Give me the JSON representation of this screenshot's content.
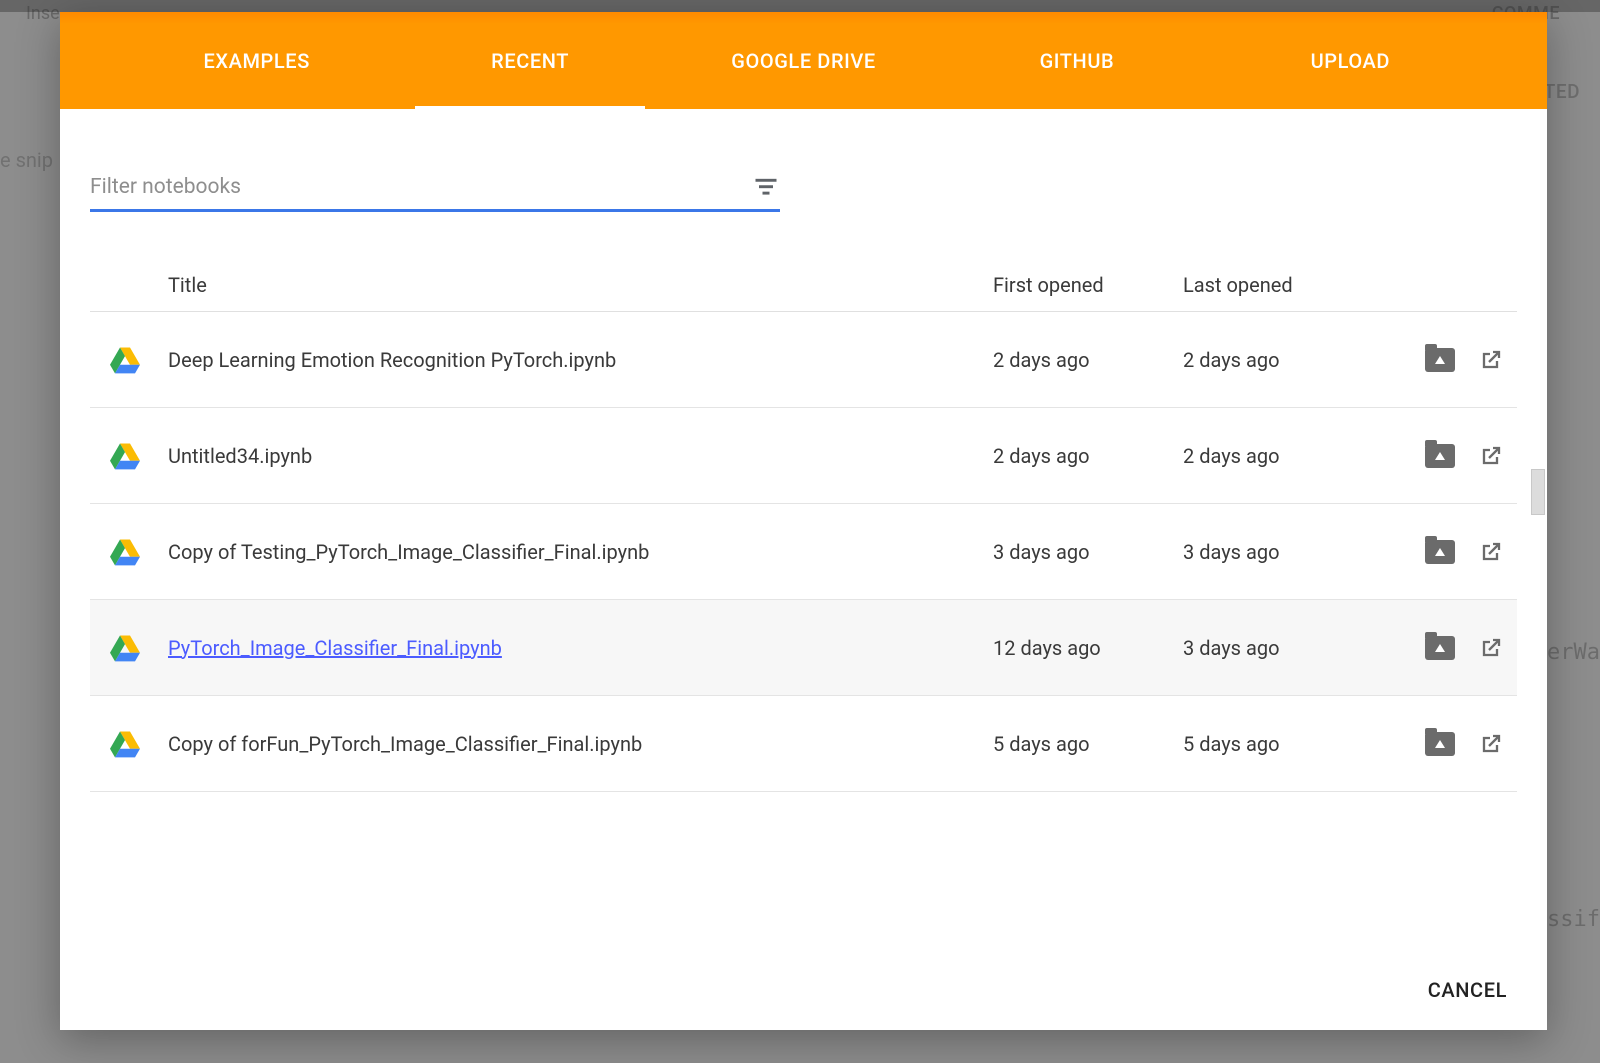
{
  "tabs": [
    {
      "label": "EXAMPLES"
    },
    {
      "label": "RECENT"
    },
    {
      "label": "GOOGLE DRIVE"
    },
    {
      "label": "GITHUB"
    },
    {
      "label": "UPLOAD"
    }
  ],
  "active_tab_index": 1,
  "filter": {
    "placeholder": "Filter notebooks",
    "value": ""
  },
  "columns": {
    "title": "Title",
    "first": "First opened",
    "last": "Last opened"
  },
  "rows": [
    {
      "title": "Deep Learning Emotion Recognition PyTorch.ipynb",
      "first": "2 days ago",
      "last": "2 days ago",
      "hover": false,
      "link": false
    },
    {
      "title": "Untitled34.ipynb",
      "first": "2 days ago",
      "last": "2 days ago",
      "hover": false,
      "link": false
    },
    {
      "title": "Copy of Testing_PyTorch_Image_Classifier_Final.ipynb",
      "first": "3 days ago",
      "last": "3 days ago",
      "hover": false,
      "link": false
    },
    {
      "title": "PyTorch_Image_Classifier_Final.ipynb",
      "first": "12 days ago",
      "last": "3 days ago",
      "hover": true,
      "link": true
    },
    {
      "title": "Copy of forFun_PyTorch_Image_Classifier_Final.ipynb",
      "first": "5 days ago",
      "last": "5 days ago",
      "hover": false,
      "link": false
    }
  ],
  "footer": {
    "cancel": "CANCEL"
  },
  "bg": {
    "t1": "Inse",
    "t2": "COMME",
    "t3": "TED",
    "t4": "e snip",
    "t5": "erWa",
    "t6": "ssif"
  }
}
